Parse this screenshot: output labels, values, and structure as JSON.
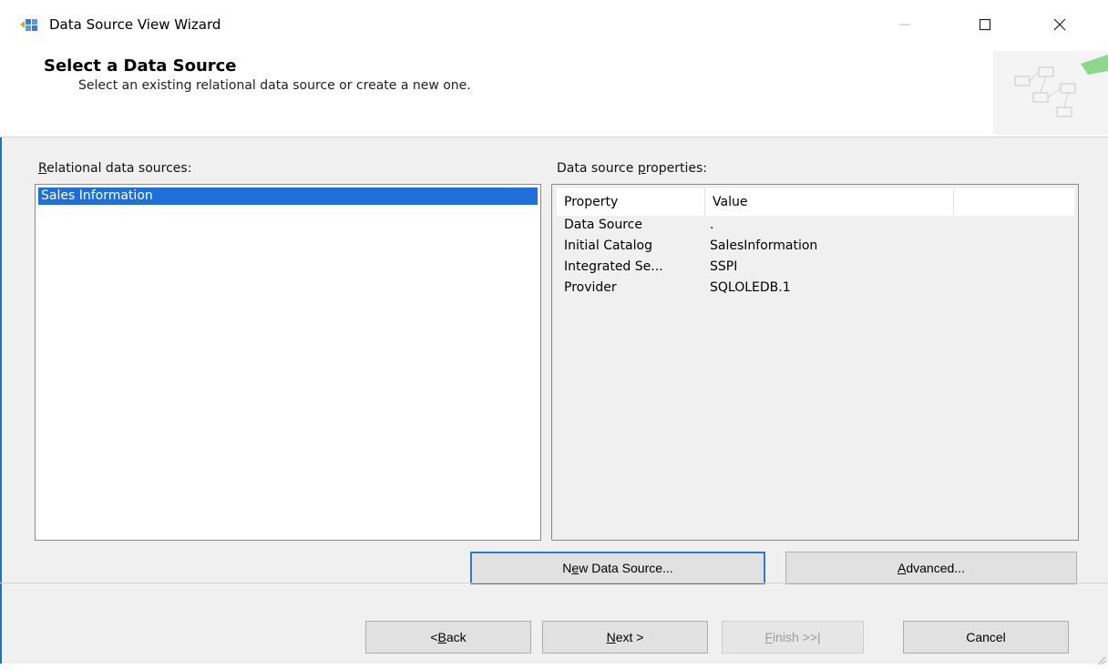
{
  "window": {
    "title": "Data Source View Wizard"
  },
  "header": {
    "title": "Select a Data Source",
    "subtitle": "Select an existing relational data source or create a new one."
  },
  "left": {
    "label_mnemonic": "R",
    "label_rest": "elational data sources:",
    "items": [
      "Sales Information"
    ]
  },
  "right": {
    "label_before": "Data source ",
    "label_mnemonic": "p",
    "label_after": "roperties:",
    "columns": [
      "Property",
      "Value",
      ""
    ],
    "rows": [
      {
        "property": "Data Source",
        "value": "."
      },
      {
        "property": "Initial Catalog",
        "value": "SalesInformation"
      },
      {
        "property": "Integrated Se...",
        "value": "SSPI"
      },
      {
        "property": "Provider",
        "value": "SQLOLEDB.1"
      }
    ]
  },
  "buttons": {
    "new_ds_before": "N",
    "new_ds_mnemonic": "e",
    "new_ds_after": "w Data Source...",
    "advanced_mnemonic": "A",
    "advanced_after": "dvanced...",
    "back_before": "< ",
    "back_mnemonic": "B",
    "back_after": "ack",
    "next_mnemonic": "N",
    "next_after": "ext >",
    "finish_mnemonic": "F",
    "finish_after": "inish >>|",
    "cancel": "Cancel"
  },
  "colors": {
    "selection": "#1e6fd9",
    "primary_border": "#2b79d0",
    "accent": "#1a73c9"
  }
}
